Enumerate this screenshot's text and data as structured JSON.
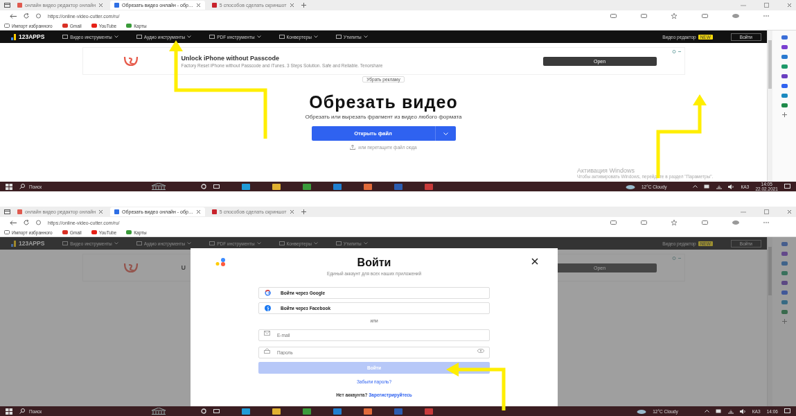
{
  "screens": [
    {
      "browser": {
        "tabs": [
          {
            "title": "онлайн видео редактор онлайн",
            "selected": false,
            "color": "#e05a4f"
          },
          {
            "title": "Обрезать видео онлайн - обр…",
            "selected": true,
            "color": "#2f6fe4"
          },
          {
            "title": "5 способов сделать скриншот",
            "selected": false,
            "color": "#c8232c"
          }
        ],
        "address": "https://online-video-cutter.com/ru/",
        "bookmarks": [
          "Импорт избранного",
          "Gmail",
          "YouTube",
          "Карты"
        ]
      },
      "site": {
        "logo": "123APPS",
        "menus": [
          "Видео инструменты",
          "Аудио инструменты",
          "PDF инструменты",
          "Конвертеры",
          "Утилиты"
        ],
        "editor_link": "Видео редактор",
        "editor_badge": "NEW",
        "login_button": "Войти"
      },
      "ad": {
        "title": "Unlock iPhone without Passcode",
        "text": "Factory Reset iPhone without Passcode and iTunes. 3 Steps Solution. Safe and Reliable. Tenorshare",
        "button": "Open",
        "remove": "Убрать рекламу"
      },
      "hero": {
        "heading": "Обрезать видео",
        "subtitle": "Обрезать или вырезать фрагмент из видео любого формата",
        "open_button": "Открыть файл",
        "drop_hint": "или перетащите файл сюда"
      },
      "activation": {
        "title": "Активация Windows",
        "text": "Чтобы активировать Windows, перейдите в раздел \"Параметры\"."
      },
      "taskbar": {
        "search": "Поиск",
        "weather": "12°C Cloudy",
        "lang": "КАЗ",
        "time": "14:05",
        "date": "22.02.2021"
      }
    },
    {
      "browser": {
        "tabs": [
          {
            "title": "онлайн видео редактор онлайн",
            "selected": false,
            "color": "#e05a4f"
          },
          {
            "title": "Обрезать видео онлайн - обр…",
            "selected": true,
            "color": "#2f6fe4"
          },
          {
            "title": "5 способов сделать скриншот",
            "selected": false,
            "color": "#c8232c"
          }
        ],
        "address": "https://online-video-cutter.com/ru/",
        "bookmarks": [
          "Импорт избранного",
          "Gmail",
          "YouTube",
          "Карты"
        ]
      },
      "site": {
        "logo": "123APPS",
        "menus": [
          "Видео инструменты",
          "Аудио инструменты",
          "PDF инструменты",
          "Конвертеры",
          "Утилиты"
        ],
        "editor_link": "Видео редактор",
        "editor_badge": "NEW",
        "login_button": "Войти"
      },
      "ad": {
        "title": "U",
        "button": "Open"
      },
      "modal": {
        "title": "Войти",
        "subtitle": "Единый аккаунт для всех наших приложений",
        "google_button": "Войти через Google",
        "facebook_button": "Войти через Facebook",
        "separator": "или",
        "email_placeholder": "E-mail",
        "password_placeholder": "Пароль",
        "submit": {
          "label": "Войти",
          "disabled": true
        },
        "forgot_link": "Забыли пароль?",
        "footer_text": "Нет аккаунта?",
        "register_link": "Зарегистрируйтесь"
      },
      "taskbar": {
        "search": "Поиск",
        "weather": "12°C Cloudy",
        "lang": "КАЗ",
        "time": "14:06"
      }
    }
  ]
}
